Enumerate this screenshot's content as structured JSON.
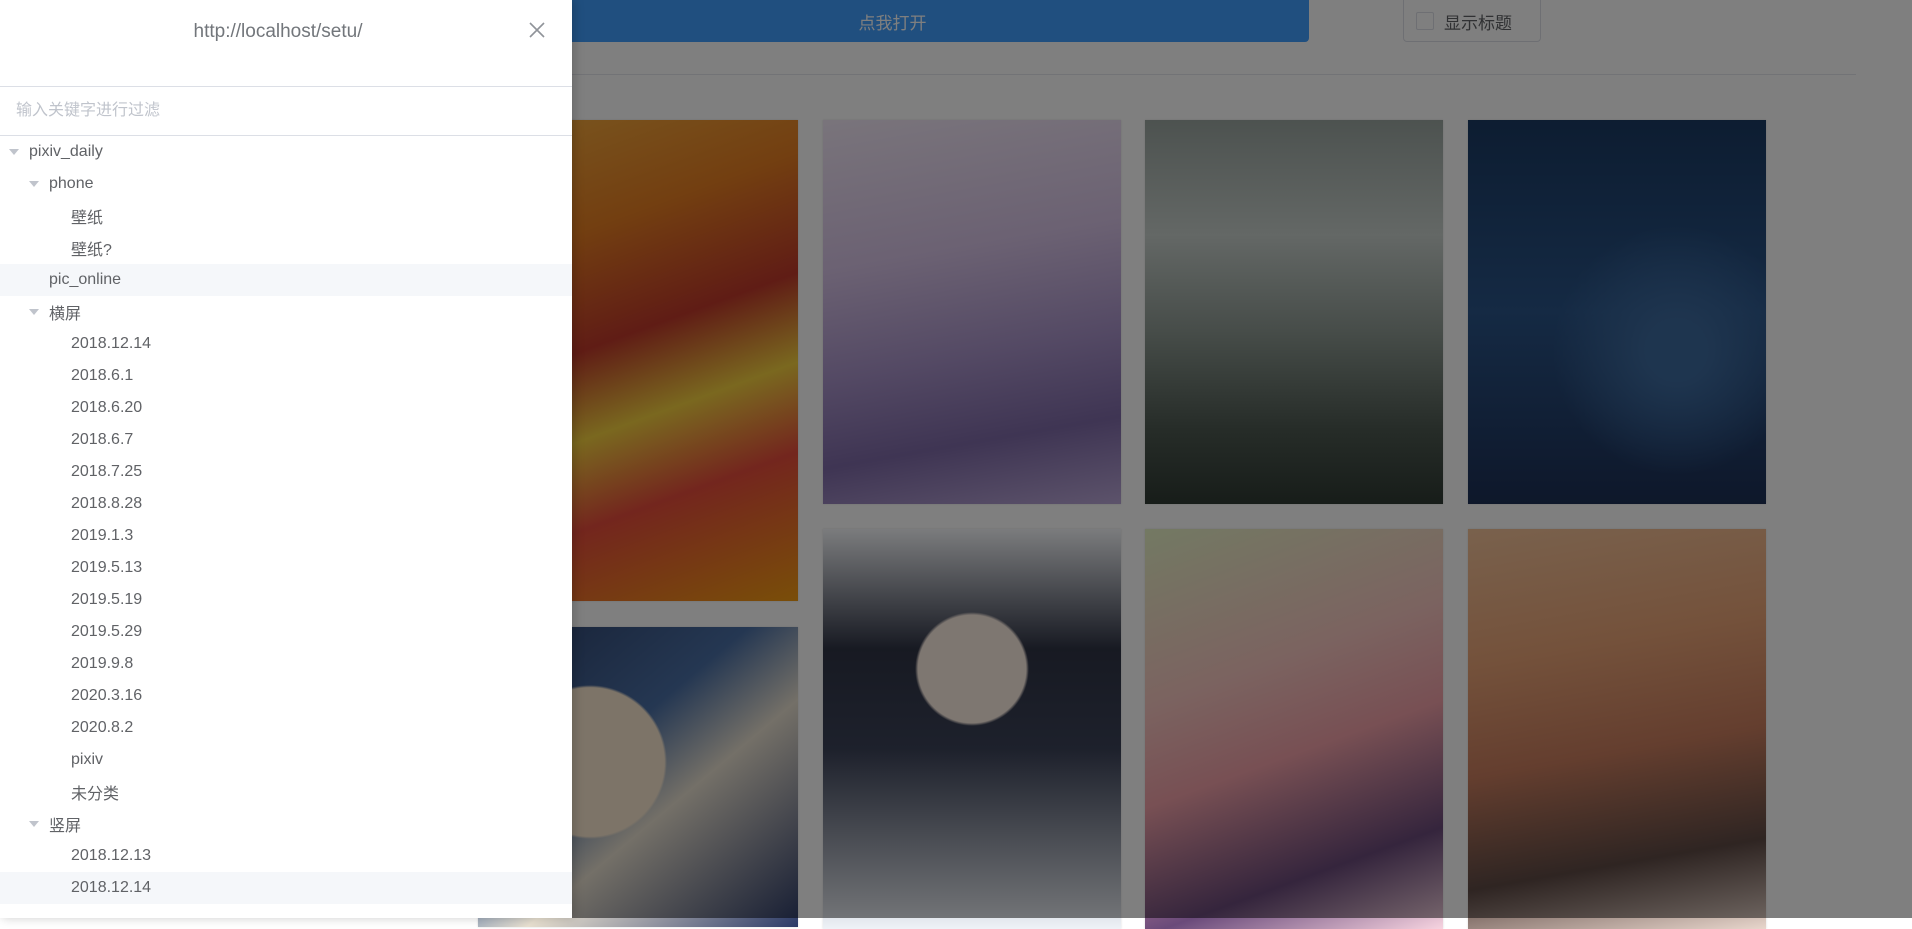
{
  "toolbar": {
    "open_label": "点我打开",
    "show_title_label": "显示标题",
    "show_title_checked": false
  },
  "drawer": {
    "title": "http://localhost/setu/",
    "filter_placeholder": "输入关键字进行过滤",
    "filter_value": "",
    "tree": [
      {
        "label": "pixiv_daily",
        "level": 0,
        "expanded": true
      },
      {
        "label": "phone",
        "level": 1,
        "expanded": true
      },
      {
        "label": "壁纸",
        "level": 2
      },
      {
        "label": "壁纸?",
        "level": 2
      },
      {
        "label": "pic_online",
        "level": 1,
        "highlighted": true
      },
      {
        "label": "横屏",
        "level": 1,
        "expanded": true
      },
      {
        "label": "2018.12.14",
        "level": 2
      },
      {
        "label": "2018.6.1",
        "level": 2
      },
      {
        "label": "2018.6.20",
        "level": 2
      },
      {
        "label": "2018.6.7",
        "level": 2
      },
      {
        "label": "2018.7.25",
        "level": 2
      },
      {
        "label": "2018.8.28",
        "level": 2
      },
      {
        "label": "2019.1.3",
        "level": 2
      },
      {
        "label": "2019.5.13",
        "level": 2
      },
      {
        "label": "2019.5.19",
        "level": 2
      },
      {
        "label": "2019.5.29",
        "level": 2
      },
      {
        "label": "2019.9.8",
        "level": 2
      },
      {
        "label": "2020.3.16",
        "level": 2
      },
      {
        "label": "2020.8.2",
        "level": 2
      },
      {
        "label": "pixiv",
        "level": 2
      },
      {
        "label": "未分类",
        "level": 2
      },
      {
        "label": "竖屏",
        "level": 1,
        "expanded": true
      },
      {
        "label": "2018.12.13",
        "level": 2
      },
      {
        "label": "2018.12.14",
        "level": 2,
        "highlighted": true
      }
    ]
  },
  "colors": {
    "primary": "#409eff",
    "mask": "rgba(0,0,0,0.5)",
    "text": "#606266"
  }
}
